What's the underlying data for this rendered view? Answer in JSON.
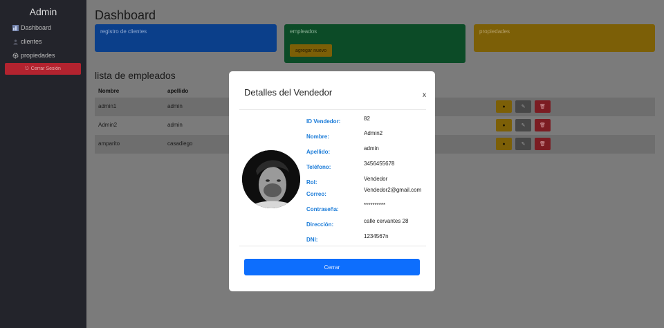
{
  "sidebar": {
    "title": "Admin",
    "items": [
      {
        "label": "Dashboard",
        "icon": "dashboard-icon"
      },
      {
        "label": "clientes",
        "icon": "user-icon"
      },
      {
        "label": "propiedades",
        "icon": "gear-icon"
      }
    ],
    "logout_label": "Cerrar Sesión"
  },
  "main": {
    "title": "Dashboard",
    "cards": {
      "clientes": "registro de clientes",
      "empleados": "empleados",
      "agregar": "agregar nuevo",
      "propiedades": "propiedades"
    },
    "list_title": "lista de empleados",
    "columns": [
      "Nombre",
      "apellido"
    ],
    "rows": [
      {
        "nombre": "admin1",
        "apellido": "admin"
      },
      {
        "nombre": "Admin2",
        "apellido": "admin"
      },
      {
        "nombre": "amparito",
        "apellido": "casadiego"
      }
    ],
    "action_icons": {
      "view": "eye-icon",
      "edit": "edit-icon",
      "delete": "trash-icon"
    }
  },
  "modal": {
    "title": "Detalles del Vendedor",
    "close_label": "x",
    "fields": [
      {
        "label": "ID Vendedor:",
        "value": "82"
      },
      {
        "label": "Nombre:",
        "value": "Admin2"
      },
      {
        "label": "Apellido:",
        "value": "admin"
      },
      {
        "label": "Teléfono:",
        "value": "3456455678"
      },
      {
        "label": "Rol:",
        "value": "Vendedor"
      },
      {
        "label": "Correo:",
        "value": "Vendedor2@gmail.com"
      },
      {
        "label": "Contraseña:",
        "value": "**********"
      },
      {
        "label": "Dirección:",
        "value": "calle cervantes 28"
      },
      {
        "label": "DNI:",
        "value": "1234567n"
      }
    ],
    "cerrar_label": "Cerrar"
  },
  "colors": {
    "primary": "#0d6efd",
    "label_blue": "#1a7bd8",
    "warning": "#ffc107",
    "danger": "#dc3545",
    "success": "#198754",
    "sidebar_bg": "#23242b"
  }
}
